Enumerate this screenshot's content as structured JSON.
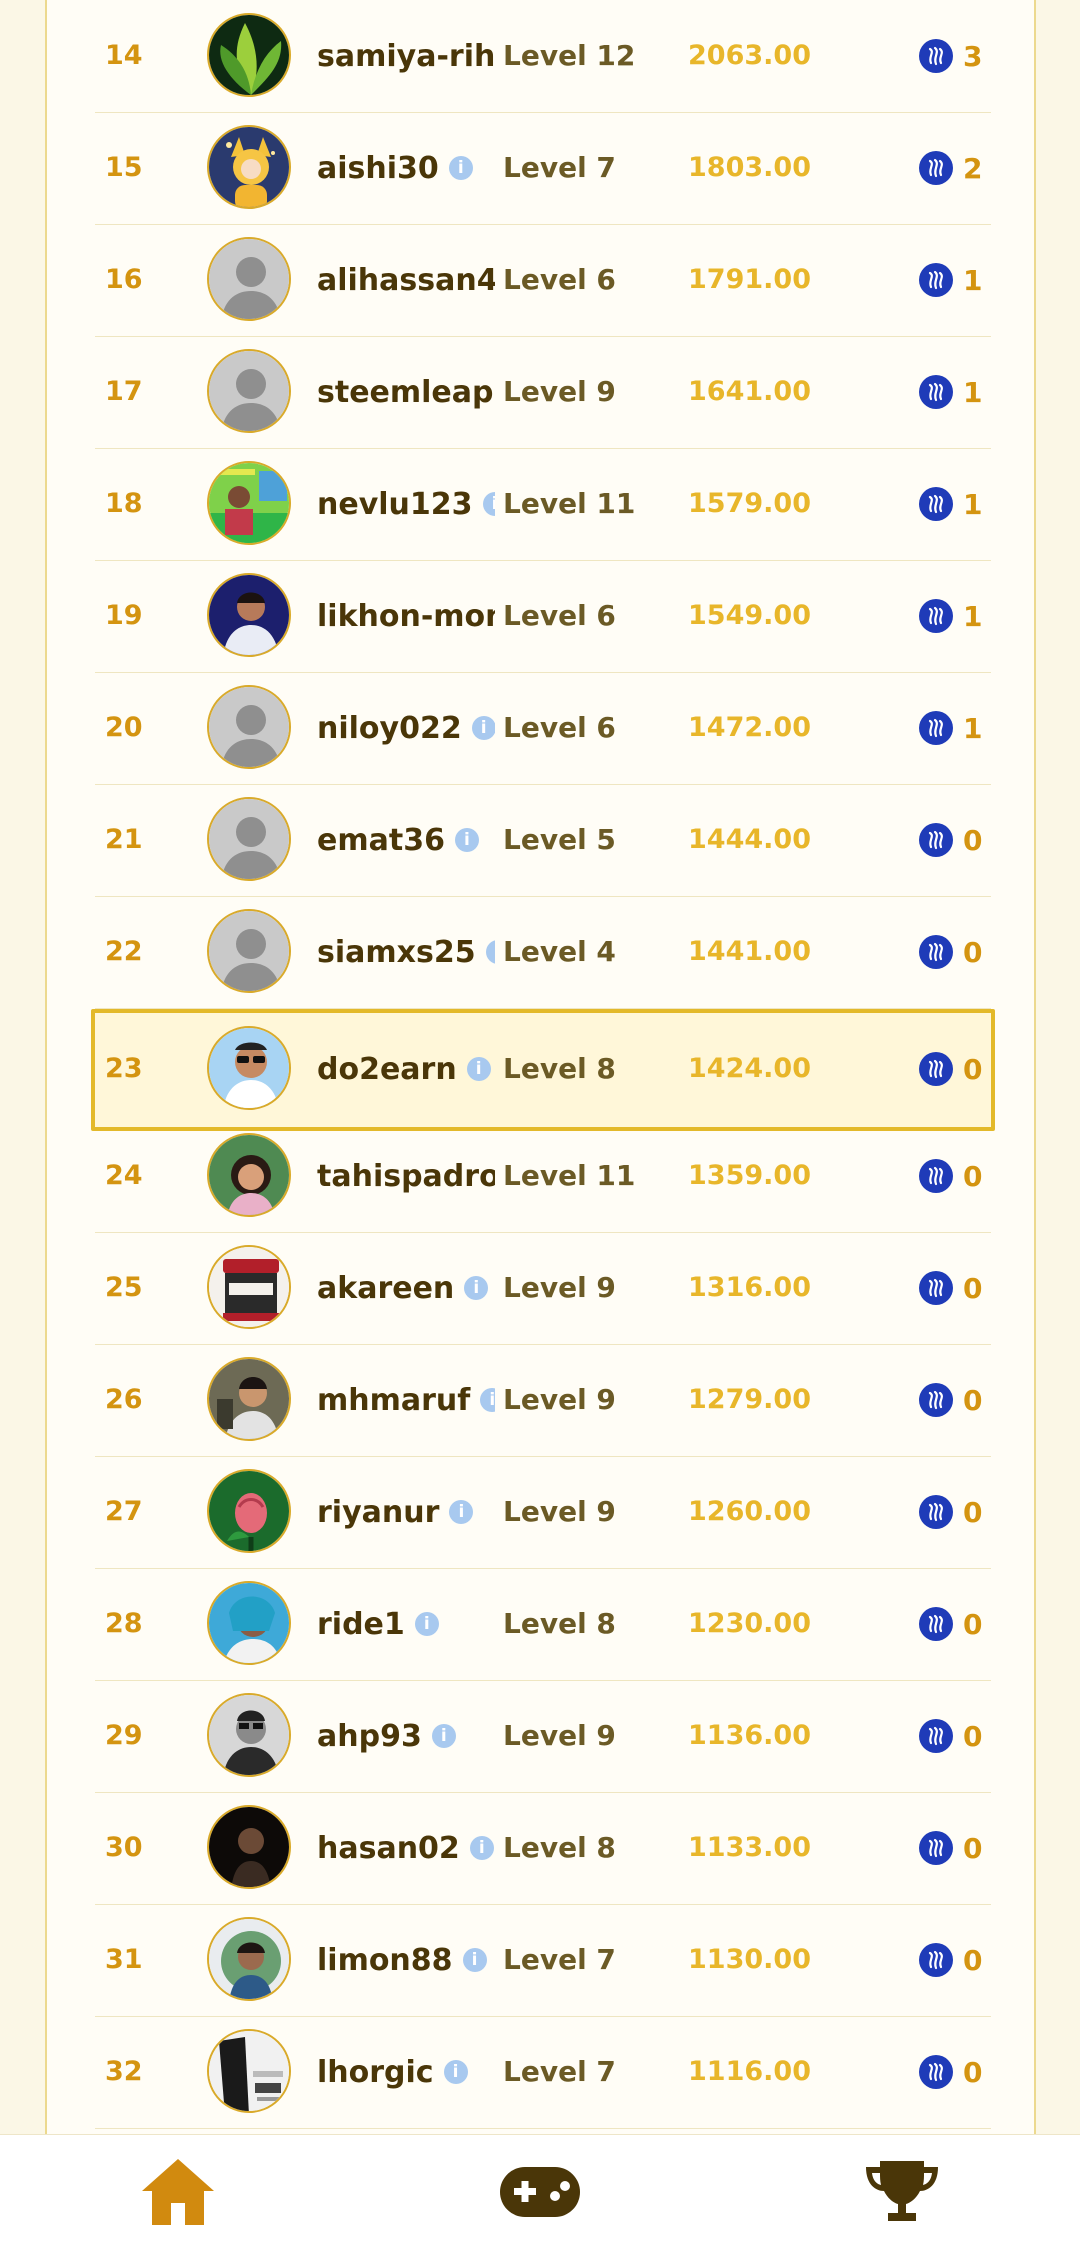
{
  "leaderboard": {
    "rows": [
      {
        "rank": "14",
        "username": "samiya-rihc",
        "level": "Level 12",
        "score": "2063.00",
        "reward": "3",
        "avatar": "leaf"
      },
      {
        "rank": "15",
        "username": "aishi30",
        "level": "Level 7",
        "score": "1803.00",
        "reward": "2",
        "avatar": "cartoon"
      },
      {
        "rank": "16",
        "username": "alihassan4",
        "level": "Level 6",
        "score": "1791.00",
        "reward": "1",
        "avatar": "default"
      },
      {
        "rank": "17",
        "username": "steemleap",
        "level": "Level 9",
        "score": "1641.00",
        "reward": "1",
        "avatar": "default"
      },
      {
        "rank": "18",
        "username": "nevlu123",
        "level": "Level 11",
        "score": "1579.00",
        "reward": "1",
        "avatar": "green-photo"
      },
      {
        "rank": "19",
        "username": "likhon-mon",
        "level": "Level 6",
        "score": "1549.00",
        "reward": "1",
        "avatar": "blue-photo"
      },
      {
        "rank": "20",
        "username": "niloy022",
        "level": "Level 6",
        "score": "1472.00",
        "reward": "1",
        "avatar": "default"
      },
      {
        "rank": "21",
        "username": "emat36",
        "level": "Level 5",
        "score": "1444.00",
        "reward": "0",
        "avatar": "default"
      },
      {
        "rank": "22",
        "username": "siamxs25",
        "level": "Level 4",
        "score": "1441.00",
        "reward": "0",
        "avatar": "default"
      },
      {
        "rank": "23",
        "username": "do2earn",
        "level": "Level 8",
        "score": "1424.00",
        "reward": "0",
        "avatar": "sunglasses",
        "highlight": true
      },
      {
        "rank": "24",
        "username": "tahispadron",
        "level": "Level 11",
        "score": "1359.00",
        "reward": "0",
        "avatar": "girl-photo"
      },
      {
        "rank": "25",
        "username": "akareen",
        "level": "Level 9",
        "score": "1316.00",
        "reward": "0",
        "avatar": "product"
      },
      {
        "rank": "26",
        "username": "mhmaruf",
        "level": "Level 9",
        "score": "1279.00",
        "reward": "0",
        "avatar": "man-photo"
      },
      {
        "rank": "27",
        "username": "riyanur",
        "level": "Level 9",
        "score": "1260.00",
        "reward": "0",
        "avatar": "rose"
      },
      {
        "rank": "28",
        "username": "ride1",
        "level": "Level 8",
        "score": "1230.00",
        "reward": "0",
        "avatar": "teal-photo"
      },
      {
        "rank": "29",
        "username": "ahp93",
        "level": "Level 9",
        "score": "1136.00",
        "reward": "0",
        "avatar": "bw-photo"
      },
      {
        "rank": "30",
        "username": "hasan02",
        "level": "Level 8",
        "score": "1133.00",
        "reward": "0",
        "avatar": "dark-photo"
      },
      {
        "rank": "31",
        "username": "limon88",
        "level": "Level 7",
        "score": "1130.00",
        "reward": "0",
        "avatar": "selfie"
      },
      {
        "rank": "32",
        "username": "lhorgic",
        "level": "Level 7",
        "score": "1116.00",
        "reward": "0",
        "avatar": "poster"
      }
    ]
  },
  "info_glyph": "i",
  "nav": {
    "items": [
      {
        "icon": "home-icon"
      },
      {
        "icon": "gamepad-icon"
      },
      {
        "icon": "trophy-icon"
      }
    ]
  },
  "colors": {
    "rank": "#d49410",
    "username": "#4a3608",
    "level": "#6b5a25",
    "score": "#e8b62a",
    "steem": "#1f3bb8",
    "highlight_border": "#e3b92a",
    "nav_icon": "#d18a0f"
  }
}
